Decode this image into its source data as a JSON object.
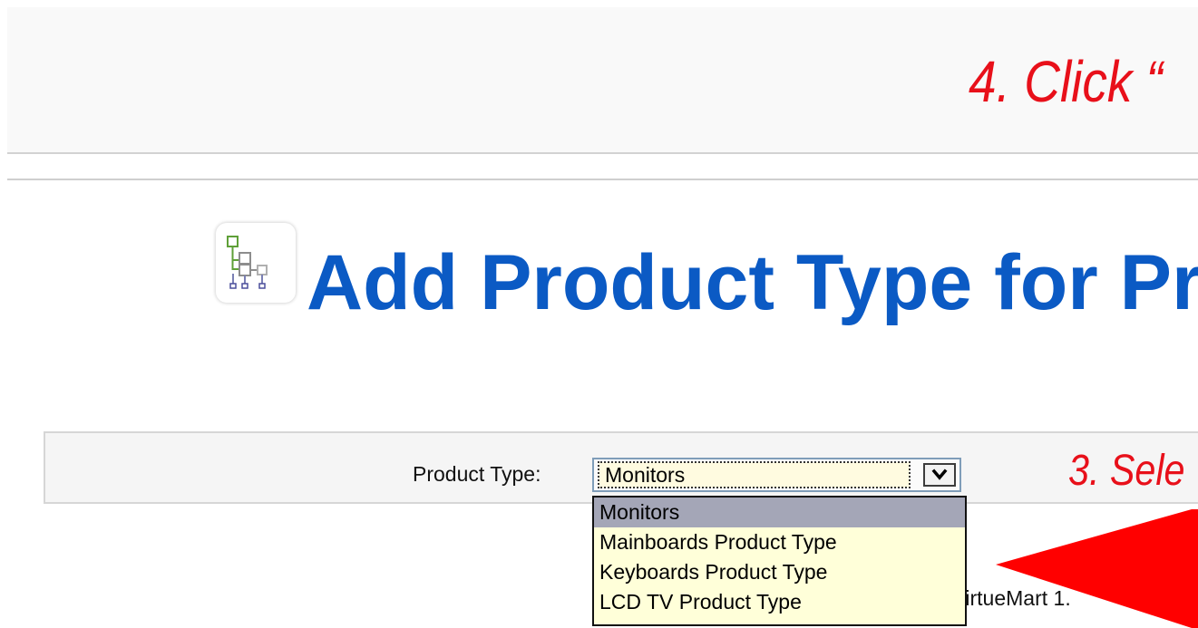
{
  "annotations": {
    "step_4": "4. Click “",
    "step_3": "3. Sele"
  },
  "header": {
    "page_title": "Add Product Type for Pr",
    "icon": "product-type-tree-icon"
  },
  "form": {
    "product_type_label": "Product Type:",
    "product_type_select": {
      "selected_value": "Monitors",
      "expanded": true,
      "options": [
        "Monitors",
        "Mainboards Product Type",
        "Keyboards Product Type",
        "LCD TV Product Type"
      ],
      "highlighted_option": "Monitors",
      "arrow_icon": "chevron-down-icon"
    }
  },
  "footer": {
    "text_fragment": "/irtueMart 1."
  },
  "colors": {
    "annotation_red": "#e8101a",
    "title_blue": "#0b5ac4",
    "dropdown_background": "#ffffd9",
    "dropdown_highlight": "#a4a6b7",
    "arrow_red": "#ff0000"
  },
  "overlay": {
    "arrow_icon": "red-arrow-icon",
    "arrow_direction": "left"
  }
}
